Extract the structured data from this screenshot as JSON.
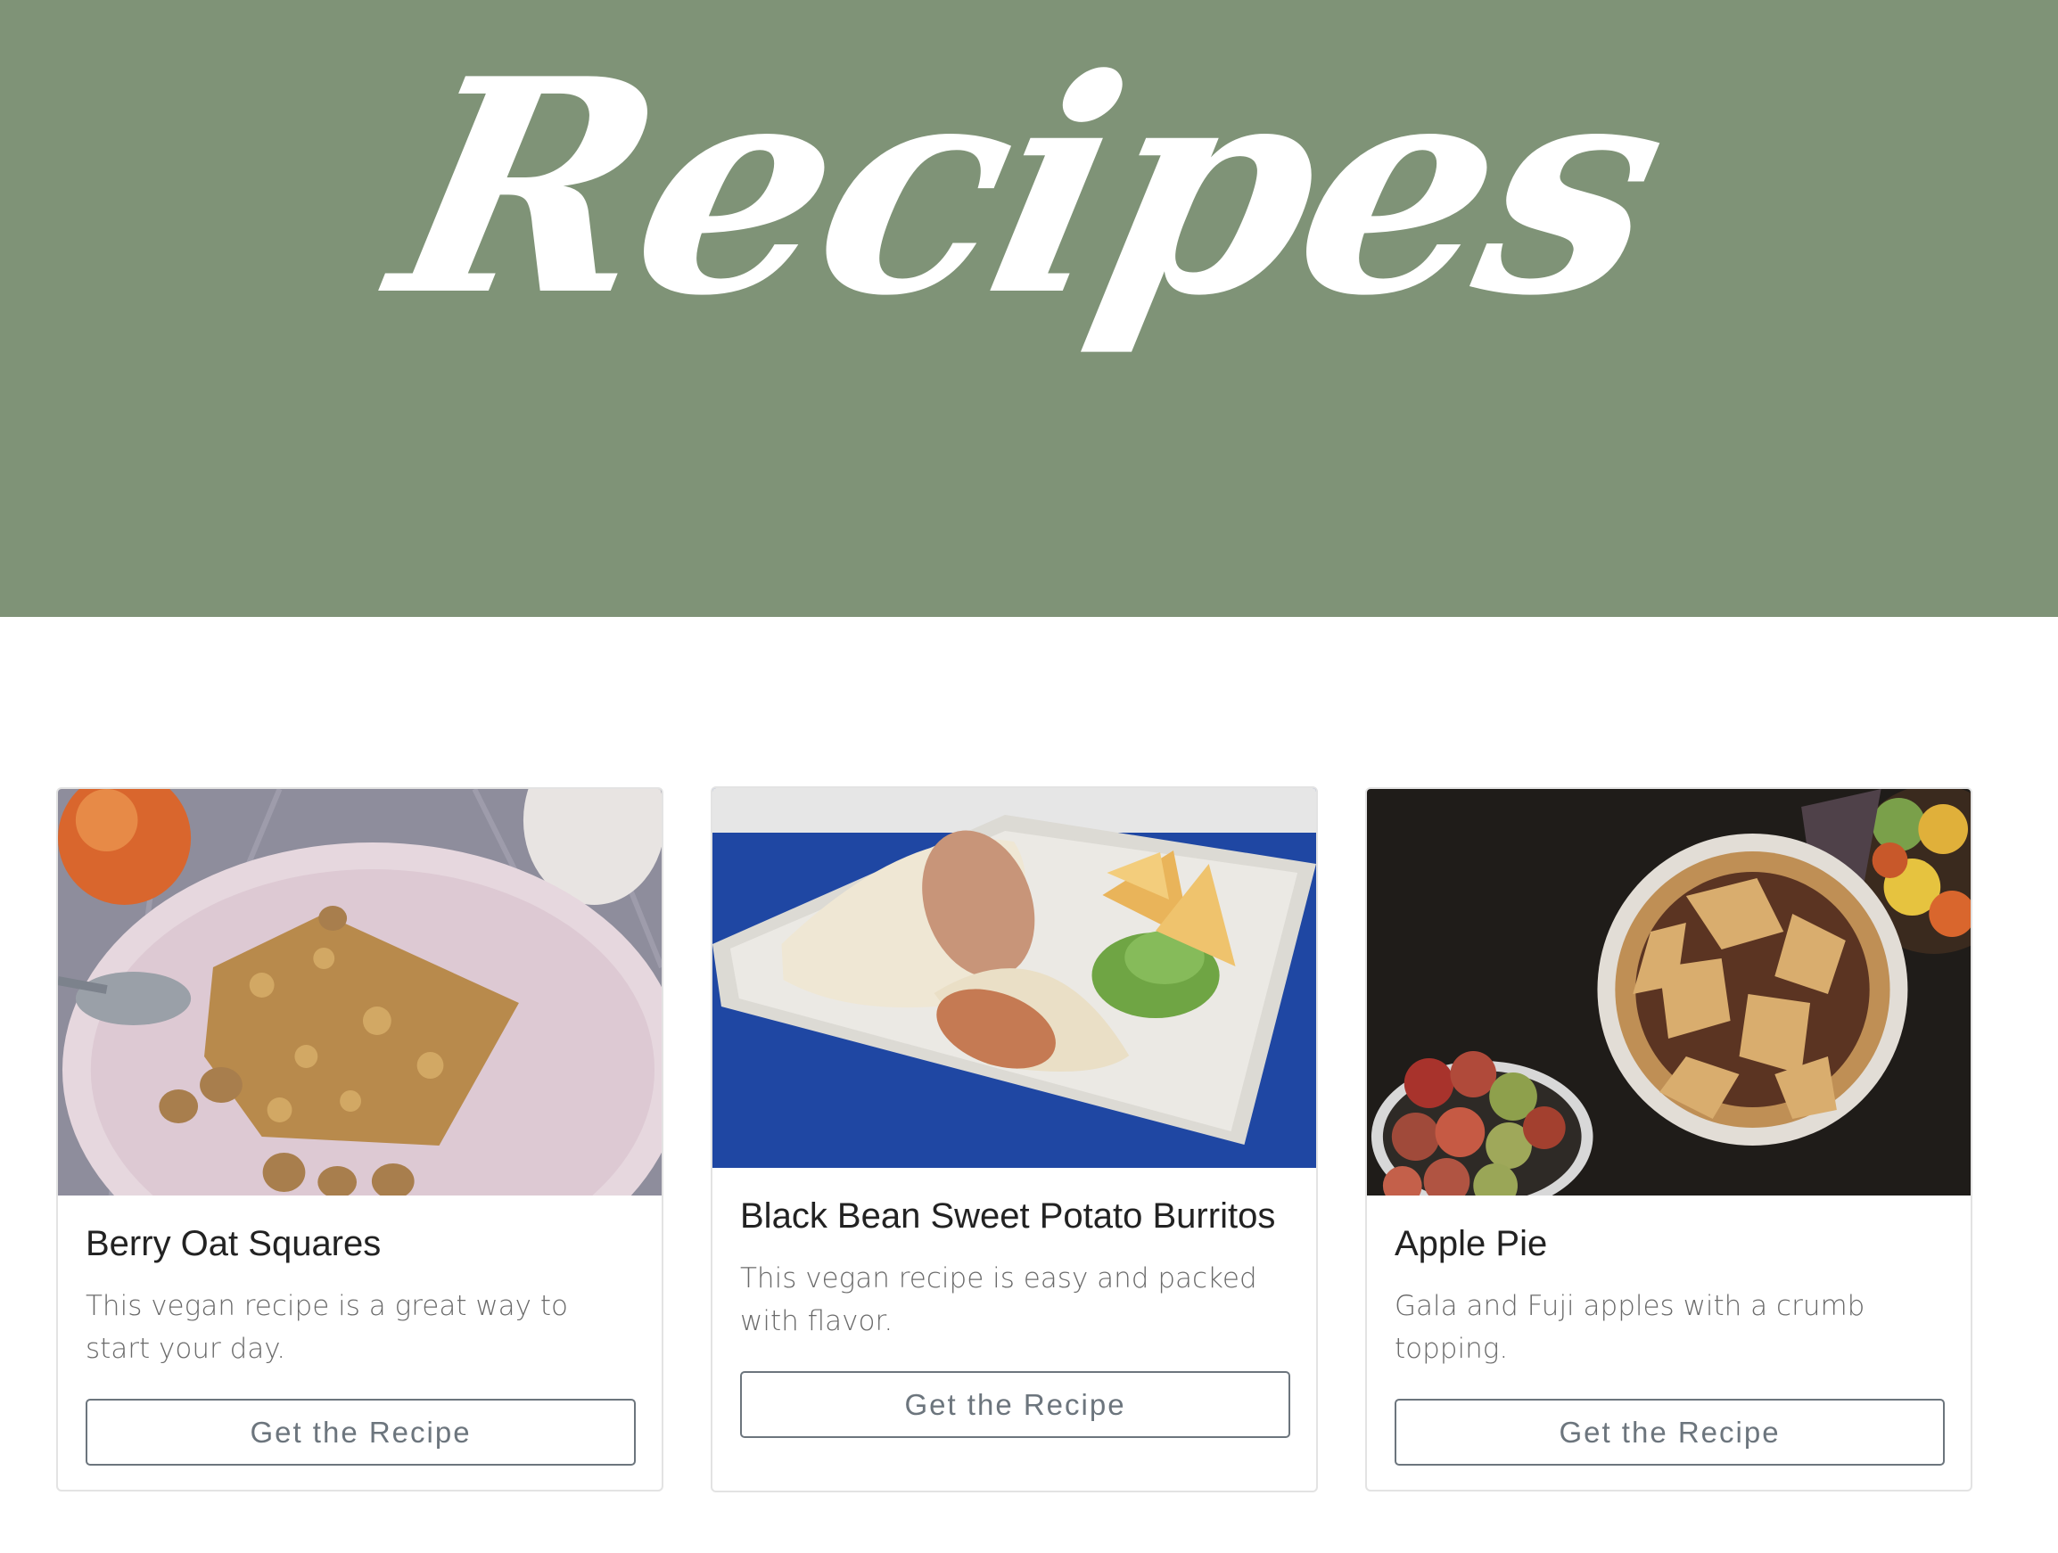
{
  "hero": {
    "title": "Recipes",
    "background_color": "#7f9377"
  },
  "cards": [
    {
      "title": "Berry Oat Squares",
      "description": "This vegan recipe is a great way to start your day.",
      "button_label": "Get the Recipe",
      "image_alt": "berry-oat-squares-photo"
    },
    {
      "title": "Black Bean Sweet Potato Burritos",
      "description": "This vegan recipe is easy and packed with flavor.",
      "button_label": "Get the Recipe",
      "image_alt": "burrito-photo"
    },
    {
      "title": "Apple Pie",
      "description": "Gala and Fuji apples with a crumb topping.",
      "button_label": "Get the Recipe",
      "image_alt": "apple-pie-photo"
    }
  ]
}
